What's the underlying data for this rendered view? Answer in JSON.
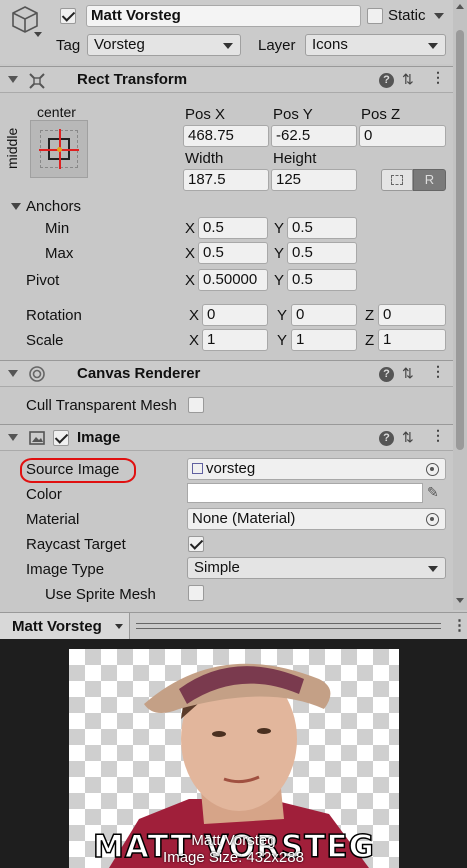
{
  "header": {
    "active": true,
    "name": "Matt Vorsteg",
    "static_label": "Static",
    "tag_label": "Tag",
    "tag_value": "Vorsteg",
    "layer_label": "Layer",
    "layer_value": "Icons"
  },
  "rect_transform": {
    "title": "Rect Transform",
    "anchor_h": "center",
    "anchor_v": "middle",
    "pos_x_label": "Pos X",
    "pos_y_label": "Pos Y",
    "pos_z_label": "Pos Z",
    "pos_x": "468.75",
    "pos_y": "-62.5",
    "pos_z": "0",
    "width_label": "Width",
    "height_label": "Height",
    "width": "187.5",
    "height": "125",
    "r_button": "R",
    "anchors_label": "Anchors",
    "min_label": "Min",
    "max_label": "Max",
    "pivot_label": "Pivot",
    "x_axis": "X",
    "y_axis": "Y",
    "z_axis": "Z",
    "min_x": "0.5",
    "min_y": "0.5",
    "max_x": "0.5",
    "max_y": "0.5",
    "pivot_x": "0.50000",
    "pivot_y": "0.5",
    "rotation_label": "Rotation",
    "rot_x": "0",
    "rot_y": "0",
    "rot_z": "0",
    "scale_label": "Scale",
    "scale_x": "1",
    "scale_y": "1",
    "scale_z": "1"
  },
  "canvas_renderer": {
    "title": "Canvas Renderer",
    "cull_label": "Cull Transparent Mesh",
    "cull_checked": false
  },
  "image": {
    "title": "Image",
    "enabled": true,
    "source_label": "Source Image",
    "source_value": "vorsteg",
    "color_label": "Color",
    "color_value": "#ffffff",
    "material_label": "Material",
    "material_value": "None (Material)",
    "raycast_label": "Raycast Target",
    "raycast_checked": true,
    "type_label": "Image Type",
    "type_value": "Simple",
    "sprite_mesh_label": "Use Sprite Mesh",
    "sprite_mesh_checked": false
  },
  "preview": {
    "title": "Matt Vorsteg",
    "banner_text": "MATT VORSTEG",
    "caption_name": "Matt Vorsteg",
    "caption_size": "Image Size: 432x288"
  },
  "colors": {
    "highlight": "#e01010"
  }
}
